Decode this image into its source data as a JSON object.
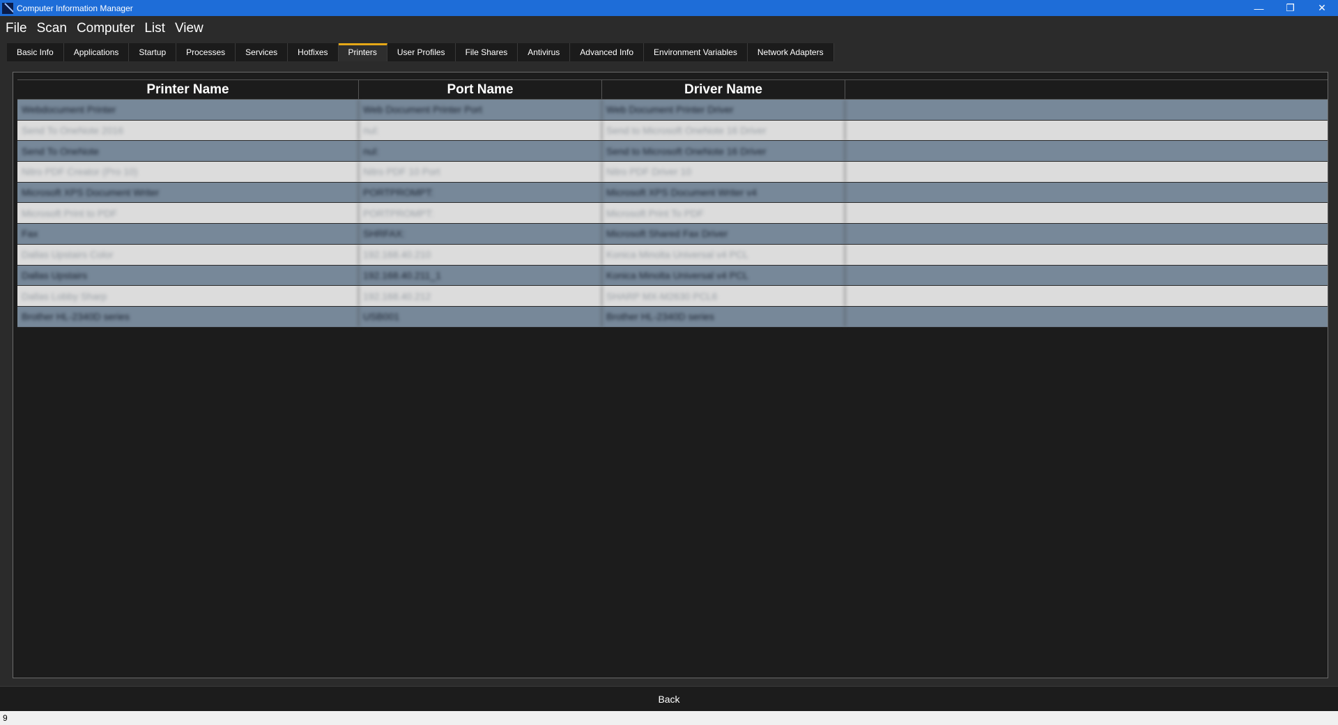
{
  "window": {
    "title": "Computer Information Manager",
    "controls": {
      "minimize": "—",
      "restore": "❐",
      "close": "✕"
    }
  },
  "menu": [
    "File",
    "Scan",
    "Computer",
    "List",
    "View"
  ],
  "tabs": [
    {
      "label": "Basic Info",
      "active": false
    },
    {
      "label": "Applications",
      "active": false
    },
    {
      "label": "Startup",
      "active": false
    },
    {
      "label": "Processes",
      "active": false
    },
    {
      "label": "Services",
      "active": false
    },
    {
      "label": "Hotfixes",
      "active": false
    },
    {
      "label": "Printers",
      "active": true
    },
    {
      "label": "User Profiles",
      "active": false
    },
    {
      "label": "File Shares",
      "active": false
    },
    {
      "label": "Antivirus",
      "active": false
    },
    {
      "label": "Advanced Info",
      "active": false
    },
    {
      "label": "Environment Variables",
      "active": false
    },
    {
      "label": "Network Adapters",
      "active": false
    }
  ],
  "grid": {
    "columns": [
      "Printer Name",
      "Port Name",
      "Driver Name",
      ""
    ],
    "rows": [
      [
        "Webdocument Printer",
        "Web Document Printer Port",
        "Web Document Printer Driver"
      ],
      [
        "Send To OneNote 2016",
        "nul:",
        "Send to Microsoft OneNote 16 Driver"
      ],
      [
        "Send To OneNote",
        "nul:",
        "Send to Microsoft OneNote 16 Driver"
      ],
      [
        "Nitro PDF Creator (Pro 10)",
        "Nitro PDF 10 Port",
        "Nitro PDF Driver 10"
      ],
      [
        "Microsoft XPS Document Writer",
        "PORTPROMPT:",
        "Microsoft XPS Document Writer v4"
      ],
      [
        "Microsoft Print to PDF",
        "PORTPROMPT:",
        "Microsoft Print To PDF"
      ],
      [
        "Fax",
        "SHRFAX:",
        "Microsoft Shared Fax Driver"
      ],
      [
        "Dallas Upstairs Color",
        "192.168.40.210",
        "Konica Minolta Universal v4 PCL"
      ],
      [
        "Dallas Upstairs",
        "192.168.40.211_1",
        "Konica Minolta Universal v4 PCL"
      ],
      [
        "Dallas Lobby Sharp",
        "192.168.40.212",
        "SHARP MX-M2630 PCL6"
      ],
      [
        "Brother HL-2340D series",
        "USB001",
        "Brother HL-2340D series"
      ]
    ]
  },
  "footer": {
    "back_label": "Back"
  },
  "status": {
    "text": "9"
  },
  "colors": {
    "titlebar": "#1e6dd8",
    "active_tab_accent": "#e6a817",
    "row_odd": "#778899",
    "row_even": "#dcdcdc"
  }
}
